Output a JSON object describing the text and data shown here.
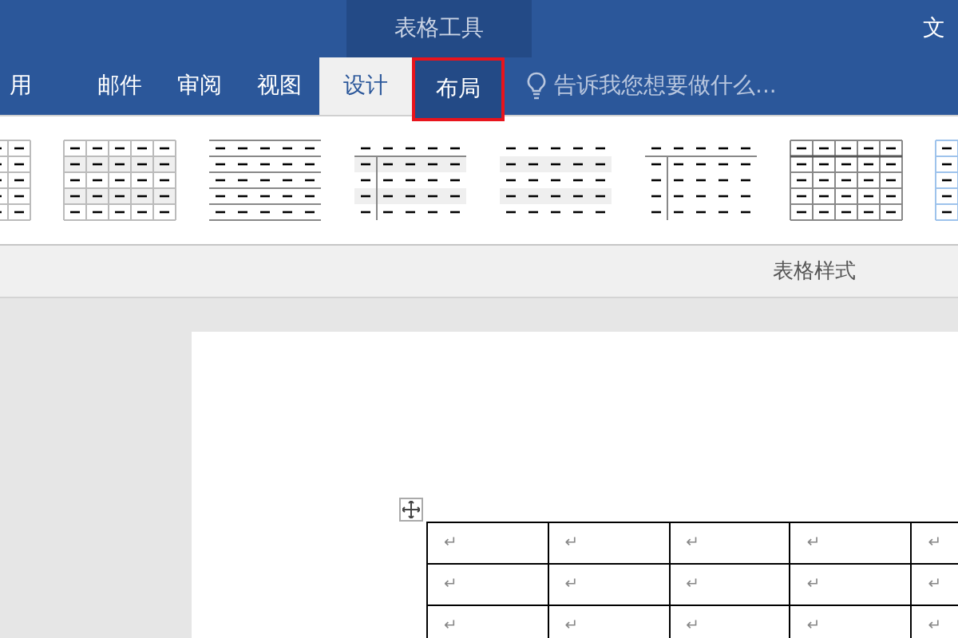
{
  "title_bar": {
    "context_group": "表格工具",
    "document_title": "文"
  },
  "tabs": [
    {
      "label": "用",
      "selected": false,
      "context": false,
      "highlighted": false
    },
    {
      "label": "邮件",
      "selected": false,
      "context": false,
      "highlighted": false
    },
    {
      "label": "审阅",
      "selected": false,
      "context": false,
      "highlighted": false
    },
    {
      "label": "视图",
      "selected": false,
      "context": false,
      "highlighted": false
    },
    {
      "label": "设计",
      "selected": true,
      "context": true,
      "highlighted": false
    },
    {
      "label": "布局",
      "selected": false,
      "context": true,
      "highlighted": true
    }
  ],
  "tell_me": {
    "placeholder": "告诉我您想要做什么..."
  },
  "table_styles": [
    {
      "kind": "grid"
    },
    {
      "kind": "grid-banded"
    },
    {
      "kind": "horizontal-lines"
    },
    {
      "kind": "first-column-banded"
    },
    {
      "kind": "banded"
    },
    {
      "kind": "first-column-lines"
    },
    {
      "kind": "grid-header"
    },
    {
      "kind": "grid-blue"
    }
  ],
  "group_label": "表格样式",
  "document_table": {
    "rows": [
      [
        "↵",
        "↵",
        "↵",
        "↵",
        "↵"
      ],
      [
        "↵",
        "↵",
        "↵",
        "↵",
        "↵"
      ],
      [
        "↵",
        "↵",
        "↵",
        "↵",
        "↵"
      ]
    ]
  }
}
